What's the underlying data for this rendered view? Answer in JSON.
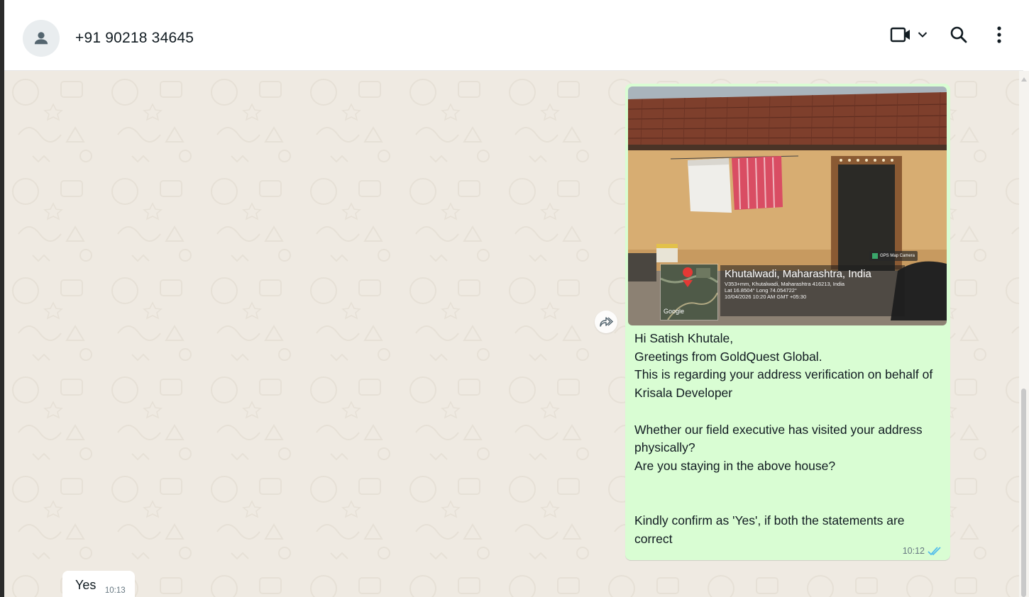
{
  "header": {
    "contact_name": "+91 90218 34645",
    "icons": [
      "avatar-person-icon",
      "video-call-icon",
      "chevron-down-icon",
      "search-icon",
      "menu-dots-icon"
    ]
  },
  "messages": {
    "outgoing": {
      "photo_overlay": {
        "location_title": "Khutalwadi, Maharashtra, India",
        "address_line": "V353+mm, Khutalwadi, Maharashtra 416213, India",
        "coords_line": "Lat 16.8504° Long 74.054722°",
        "datetime_line": "10/04/2026 10:20 AM GMT +05:30",
        "map_brand": "Google",
        "app_badge": "GPS Map Camera"
      },
      "text": "Hi Satish Khutale,\nGreetings from GoldQuest Global.\nThis is regarding your address verification on behalf of Krisala Developer\n\nWhether our field executive has visited your address physically?\nAre you staying in the above house?\n\n\nKindly confirm as 'Yes', if both the statements are correct",
      "time": "10:12",
      "status": "read",
      "status_color": "#53bdeb"
    },
    "incoming": {
      "text": "Yes",
      "time": "10:13"
    }
  },
  "colors": {
    "chat_background": "#efeae2",
    "outgoing_bubble": "#d9fdd3",
    "incoming_bubble": "#ffffff",
    "primary_text": "#111b21",
    "secondary_text": "#667781"
  }
}
